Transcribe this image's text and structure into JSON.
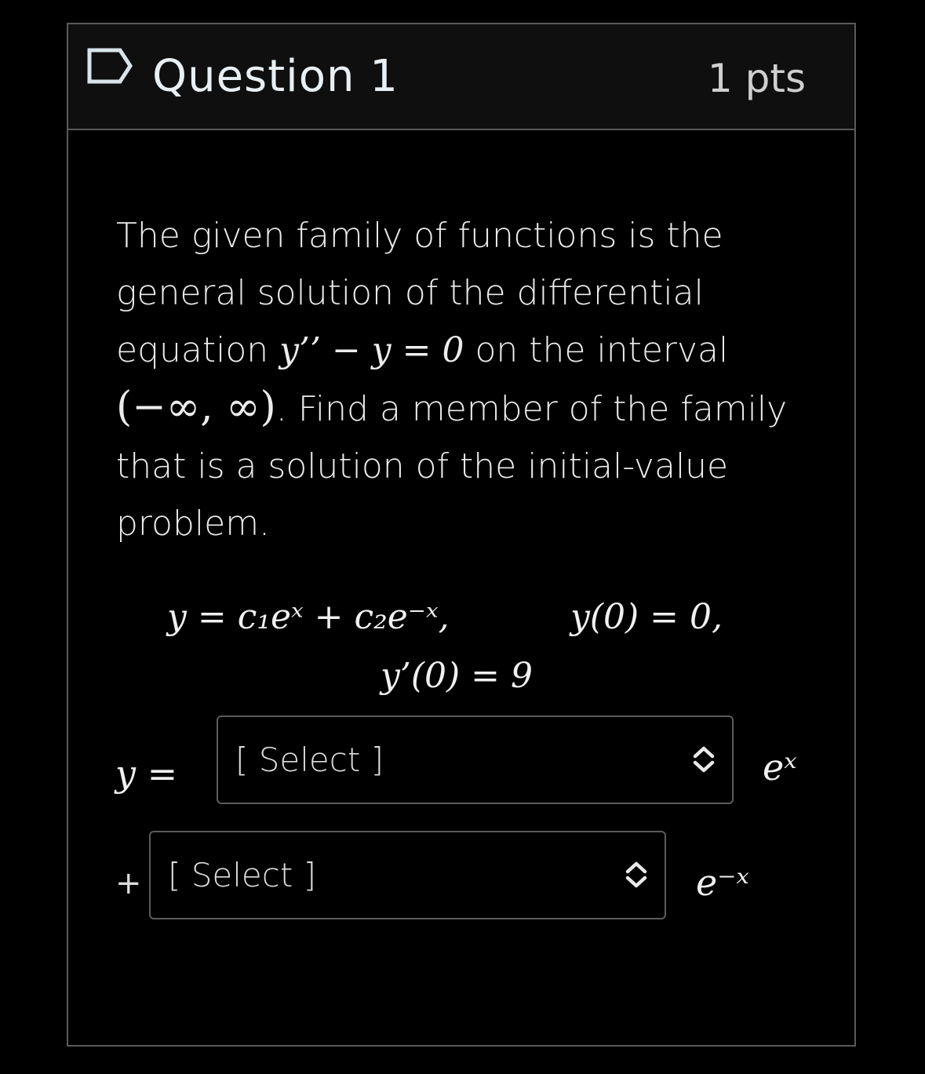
{
  "question": {
    "title": "Question 1",
    "points": "1 pts",
    "text_part1": "The given family of functions is the general solution of the differential equation ",
    "ode": "y’’ − y = 0",
    "text_part2": " on the interval ",
    "interval": "(−∞, ∞)",
    "text_part3": ". Find a member of the family that is a solution of the initial-value problem."
  },
  "equations": {
    "family": "y = c₁eˣ + c₂e⁻ˣ,",
    "ic1": "y(0) = 0,",
    "ic2": "y’(0) = 9"
  },
  "answer": {
    "lhs": "y =",
    "plus": "+",
    "select1_value": "[ Select ]",
    "select2_value": "[ Select ]",
    "term1": "eˣ",
    "term2": "e⁻ˣ"
  },
  "icons": {
    "flag": "flag-outline-icon",
    "chevron": "chevron-updown-icon"
  },
  "colors": {
    "background": "#000000",
    "border": "#5a5a5a",
    "text": "#ececec"
  }
}
